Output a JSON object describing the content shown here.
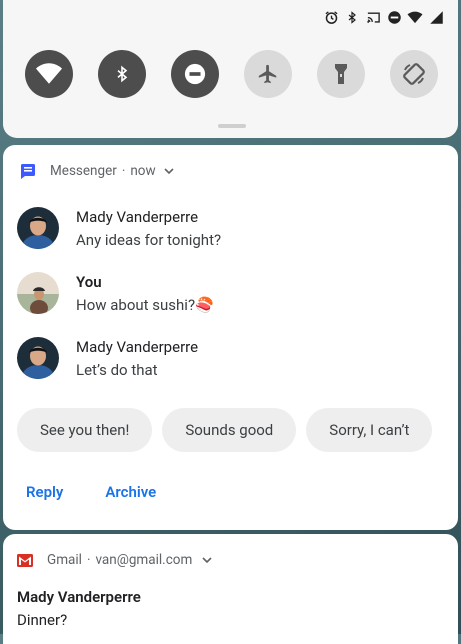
{
  "status_bar": {
    "icons": [
      "alarm-icon",
      "bluetooth-icon",
      "cast-icon",
      "dnd-icon",
      "wifi-icon",
      "signal-icon"
    ]
  },
  "quick_settings": {
    "tiles": [
      {
        "name": "wifi",
        "state": "on",
        "icon": "wifi-icon"
      },
      {
        "name": "bluetooth",
        "state": "on",
        "icon": "bluetooth-icon"
      },
      {
        "name": "do-not-disturb",
        "state": "on",
        "icon": "dnd-icon"
      },
      {
        "name": "airplane-mode",
        "state": "off",
        "icon": "airplane-icon"
      },
      {
        "name": "flashlight",
        "state": "off",
        "icon": "flashlight-icon"
      },
      {
        "name": "auto-rotate",
        "state": "off",
        "icon": "rotate-icon"
      }
    ]
  },
  "messenger": {
    "app_name": "Messenger",
    "separator": "·",
    "time": "now",
    "messages": [
      {
        "sender": "Mady Vanderperre",
        "text": "Any ideas for tonight?"
      },
      {
        "sender": "You",
        "text": "How about sushi?🍣"
      },
      {
        "sender": "Mady Vanderperre",
        "text": "Let’s do that"
      }
    ],
    "smart_replies": [
      "See you then!",
      "Sounds good",
      "Sorry, I can’t"
    ],
    "actions": {
      "reply": "Reply",
      "archive": "Archive"
    }
  },
  "gmail": {
    "app_name": "Gmail",
    "separator": "·",
    "account": "van@gmail.com",
    "sender": "Mady Vanderperre",
    "subject": "Dinner?"
  },
  "colors": {
    "accent": "#1a73e8",
    "tile_on": "#4d4d4d",
    "tile_off": "#dadada",
    "messenger_icon": "#3d5afe",
    "gmail_red": "#d93025"
  }
}
